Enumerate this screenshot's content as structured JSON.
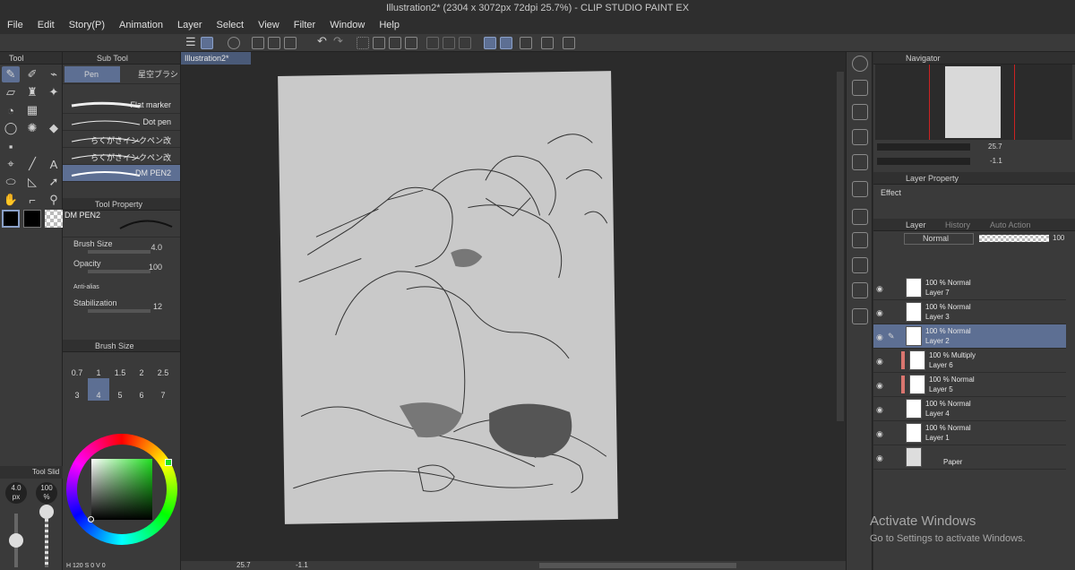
{
  "title": "Illustration2* (2304 x 3072px 72dpi 25.7%)  - CLIP STUDIO PAINT EX",
  "menu": [
    "File",
    "Edit",
    "Story(P)",
    "Animation",
    "Layer",
    "Select",
    "View",
    "Filter",
    "Window",
    "Help"
  ],
  "tool_panel": {
    "title": "Tool"
  },
  "sub_tool_panel": {
    "title": "Sub Tool",
    "tabs": [
      "Pen",
      "星空ブラシ"
    ],
    "brushes": [
      "Flat marker",
      "Dot pen",
      "らくがきインクペン改",
      "らくがきインクペン改",
      "DM PEN2"
    ],
    "selected_brush": "DM PEN2"
  },
  "tool_property": {
    "title": "Tool Property",
    "brush_name": "DM PEN2",
    "brush_size_label": "Brush Size",
    "brush_size_value": "4.0",
    "opacity_label": "Opacity",
    "opacity_value": "100",
    "anti_alias_label": "Anti-alias",
    "stabilization_label": "Stabilization",
    "stabilization_value": "12"
  },
  "brush_size_panel": {
    "title": "Brush Size",
    "row1": [
      "0.7",
      "1",
      "1.5",
      "2",
      "2.5"
    ],
    "row2": [
      "3",
      "4",
      "5",
      "6",
      "7"
    ],
    "selected": "4"
  },
  "tool_slider": {
    "title": "Tool Slid",
    "size": "4.0",
    "size_unit": "px",
    "opacity": "100",
    "opacity_unit": "%"
  },
  "color_info": {
    "h": "H 120",
    "s": "S 0",
    "v": "V 0"
  },
  "canvas": {
    "tab_label": "Illustration2*",
    "zoom": "25.7",
    "angle": "-1.1"
  },
  "navigator": {
    "title": "Navigator",
    "zoom": "25.7",
    "angle": "-1.1"
  },
  "layer_property": {
    "title": "Layer Property",
    "effect_label": "Effect"
  },
  "layer_panel": {
    "tabs": [
      "Layer",
      "History",
      "Auto Action"
    ],
    "blend_mode": "Normal",
    "opacity": "100",
    "layers": [
      {
        "mode": "100 % Normal",
        "name": "Layer 7",
        "selected": false,
        "tag": false
      },
      {
        "mode": "100 % Normal",
        "name": "Layer 3",
        "selected": false,
        "tag": false
      },
      {
        "mode": "100 % Normal",
        "name": "Layer 2",
        "selected": true,
        "tag": false
      },
      {
        "mode": "100 % Multiply",
        "name": "Layer 6",
        "selected": false,
        "tag": true
      },
      {
        "mode": "100 % Normal",
        "name": "Layer 5",
        "selected": false,
        "tag": true
      },
      {
        "mode": "100 % Normal",
        "name": "Layer 4",
        "selected": false,
        "tag": false
      },
      {
        "mode": "100 % Normal",
        "name": "Layer 1",
        "selected": false,
        "tag": false
      }
    ],
    "paper_label": "Paper"
  },
  "watermark": {
    "line1": "Activate Windows",
    "line2": "Go to Settings to activate Windows."
  },
  "colors": {
    "accent": "#5d6f93",
    "panel": "#3a3a3a",
    "canvas_bg": "#2b2b2b",
    "color_green": "#21e021"
  }
}
